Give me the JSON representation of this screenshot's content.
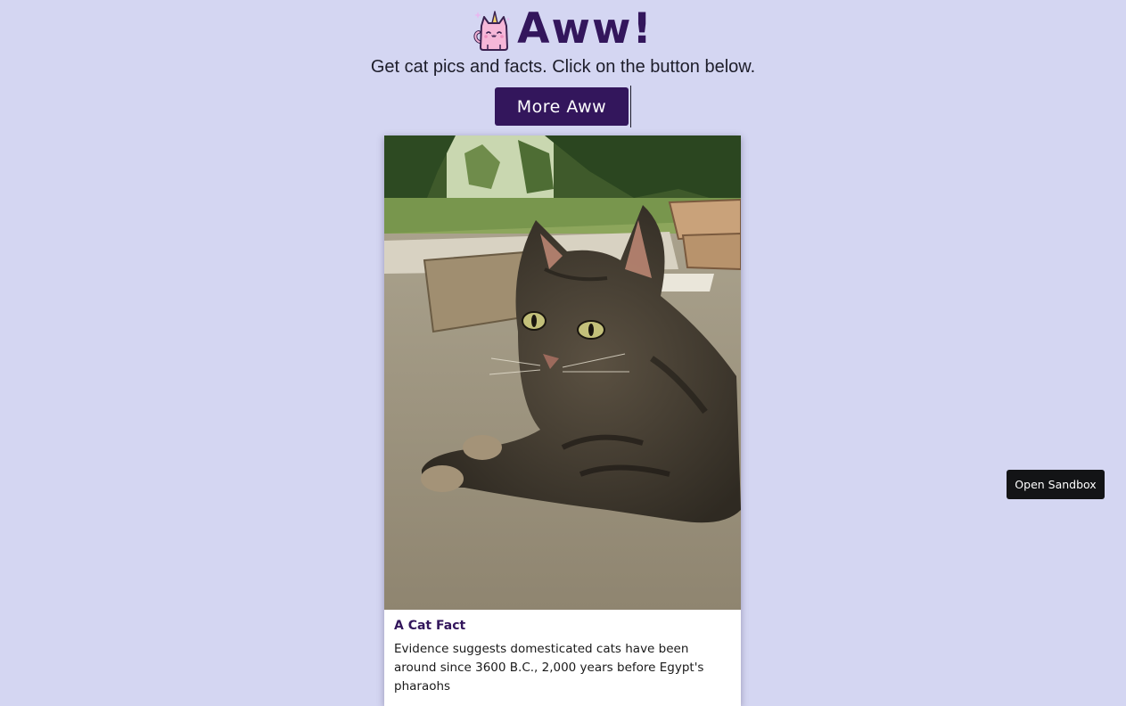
{
  "header": {
    "title": "Aww!",
    "subtitle": "Get cat pics and facts. Click on the button below.",
    "logo_icon": "unicorn-cat-icon"
  },
  "actions": {
    "more_label": "More Aww"
  },
  "card": {
    "fact_title": "A Cat Fact",
    "fact_text": "Evidence suggests domesticated cats have been around since 3600 B.C., 2,000 years before Egypt's pharaohs"
  },
  "sandbox": {
    "open_label": "Open Sandbox"
  },
  "colors": {
    "background": "#d4d6f2",
    "accent": "#33165c",
    "card": "#ffffff",
    "sandbox_button": "#131416"
  }
}
